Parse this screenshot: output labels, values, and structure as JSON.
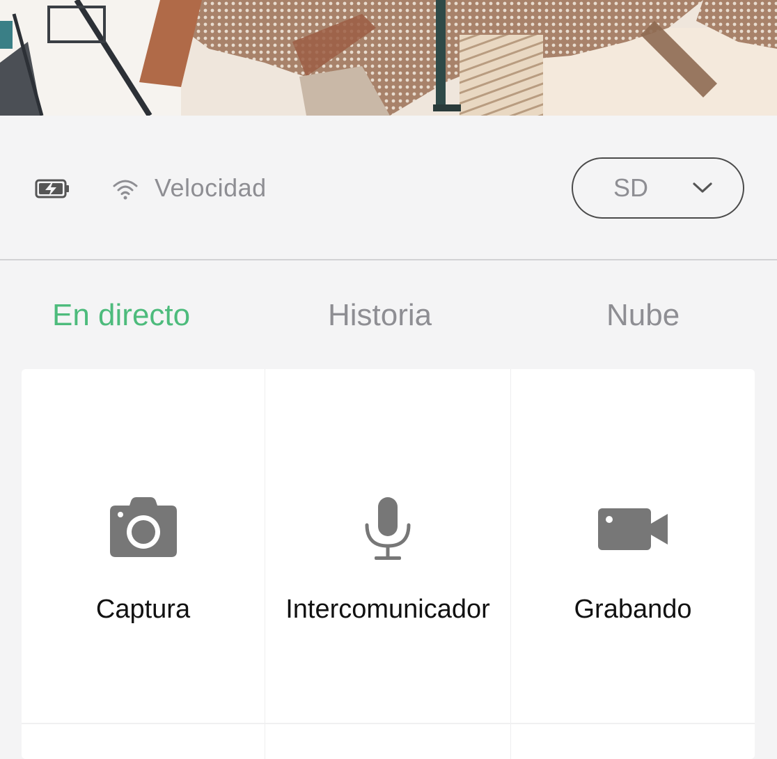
{
  "feed": {
    "description_icon": "camera-live-feed"
  },
  "status": {
    "battery_icon": "battery-charging-icon",
    "wifi_icon": "wifi-icon",
    "speed_label": "Velocidad",
    "quality": {
      "selected": "SD"
    }
  },
  "tabs": [
    {
      "label": "En directo",
      "active": true
    },
    {
      "label": "Historia",
      "active": false
    },
    {
      "label": "Nube",
      "active": false
    }
  ],
  "actions": [
    {
      "label": "Captura",
      "icon": "camera-icon"
    },
    {
      "label": "Intercomunicador",
      "icon": "microphone-icon"
    },
    {
      "label": "Grabando",
      "icon": "video-camera-icon"
    }
  ],
  "colors": {
    "accent": "#4dbb7c",
    "inactive": "#8e8e93",
    "icon": "#7a7a7a",
    "background": "#f4f4f5",
    "card": "#ffffff"
  }
}
